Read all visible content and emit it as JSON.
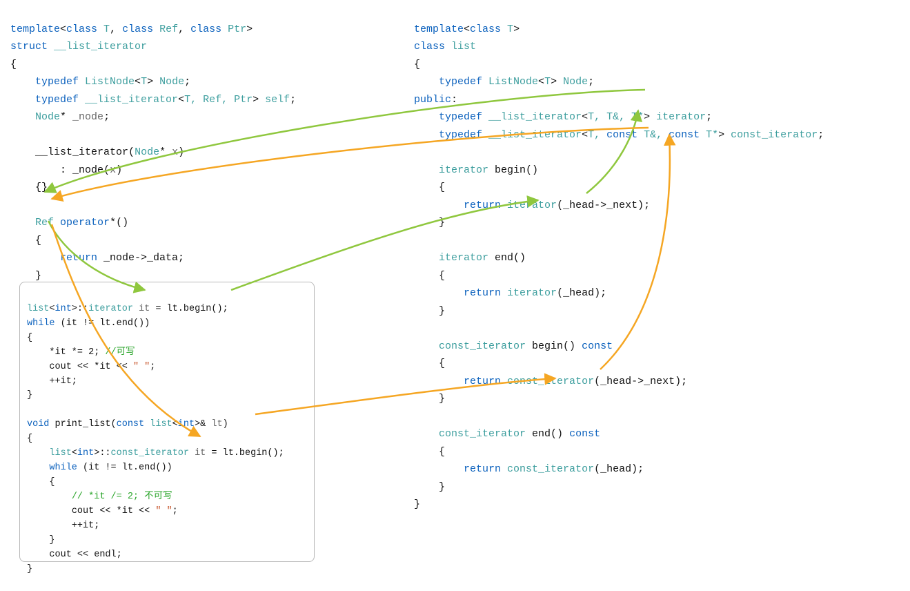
{
  "left_iterator": {
    "line1": {
      "kw1": "template",
      "p1": "<",
      "kw2": "class",
      "t1": " T",
      "c1": ", ",
      "kw3": "class",
      "t2": " Ref",
      "c2": ", ",
      "kw4": "class",
      "t3": " Ptr",
      "p2": ">"
    },
    "line2": {
      "kw": "struct",
      "name": " __list_iterator"
    },
    "line3": "{",
    "line4": {
      "indent": "    ",
      "kw": "typedef",
      "typ": " ListNode",
      "lt": "<",
      "tp": "T",
      "gt": "> ",
      "nm": "Node",
      "end": ";"
    },
    "line5": {
      "indent": "    ",
      "kw": "typedef",
      "typ": " __list_iterator",
      "lt": "<",
      "tp": "T, Ref, Ptr",
      "gt": "> ",
      "nm": "self",
      "end": ";"
    },
    "line6": {
      "indent": "    ",
      "typ": "Node",
      "star": "* ",
      "nm": "_node",
      "end": ";"
    },
    "line8": {
      "indent": "    ",
      "fn": "__list_iterator",
      "open": "(",
      "ptyp": "Node",
      "star": "* ",
      "px": "x",
      "close": ")"
    },
    "line9": {
      "indent": "        ",
      "colon": ": ",
      "fn": "_node",
      "open": "(",
      "arg": "x",
      "close": ")"
    },
    "line10": {
      "indent": "    ",
      "body": "{}"
    },
    "line12": {
      "indent": "    ",
      "typ": "Ref",
      "sp": " ",
      "kw": "operator",
      "op": "*()"
    },
    "line13": {
      "indent": "    ",
      "b": "{"
    },
    "line14": {
      "indent": "        ",
      "kw": "return",
      "expr": " _node->_data;"
    },
    "line15": {
      "indent": "    ",
      "b": "}"
    }
  },
  "snippet": {
    "s1": {
      "typ": "list",
      "lt": "<",
      "inn": "int",
      "gt": ">::",
      "it": "iterator",
      "sp": " ",
      "var": "it",
      "eq": " = ",
      "call": "lt.begin();"
    },
    "s2": {
      "kw": "while",
      "cond": " (it != lt.end())"
    },
    "s3": "{",
    "s4": {
      "indent": "    ",
      "expr": "*it *= 2; ",
      "cmt": "//可写"
    },
    "s5": {
      "indent": "    ",
      "cout": "cout << *it << ",
      "str": "\" \"",
      "end": ";"
    },
    "s6": {
      "indent": "    ",
      "expr": "++it;"
    },
    "s7": "}",
    "f1": {
      "kw": "void",
      "fn": " print_list(",
      "kw2": "const",
      "typ": " list",
      "lt": "<",
      "inn": "int",
      "gt": ">& ",
      "arg": "lt",
      "close": ")"
    },
    "f2": "{",
    "f3": {
      "indent": "    ",
      "typ": "list",
      "lt": "<",
      "inn": "int",
      "gt": ">::",
      "it": "const_iterator",
      "sp": " ",
      "var": "it",
      "eq": " = ",
      "call": "lt.begin();"
    },
    "f4": {
      "indent": "    ",
      "kw": "while",
      "cond": " (it != lt.end())"
    },
    "f5": {
      "indent": "    ",
      "b": "{"
    },
    "f6": {
      "indent": "        ",
      "cmt": "// *it /= 2; 不可写"
    },
    "f7": {
      "indent": "        ",
      "cout": "cout << *it << ",
      "str": "\" \"",
      "end": ";"
    },
    "f8": {
      "indent": "        ",
      "expr": "++it;"
    },
    "f9": {
      "indent": "    ",
      "b": "}"
    },
    "f10": {
      "indent": "    ",
      "cout": "cout << endl;"
    },
    "f11": "}"
  },
  "right_list": {
    "r1": {
      "kw1": "template",
      "p1": "<",
      "kw2": "class",
      "t1": " T",
      "p2": ">"
    },
    "r2": {
      "kw": "class",
      "name": " list"
    },
    "r3": "{",
    "r4": {
      "indent": "    ",
      "kw": "typedef",
      "typ": " ListNode",
      "lt": "<",
      "tp": "T",
      "gt": "> ",
      "nm": "Node",
      "end": ";"
    },
    "r5": {
      "kw": "public",
      "colon": ":"
    },
    "r6": {
      "indent": "    ",
      "kw": "typedef",
      "typ": " __list_iterator",
      "lt": "<",
      "args": "T, T&, T*",
      "gt": "> ",
      "nm": "iterator",
      "end": ";"
    },
    "r7": {
      "indent": "    ",
      "kw": "typedef",
      "typ": " __list_iterator",
      "lt": "<",
      "a1": "T, ",
      "kw2": "const",
      "a2": " T&, ",
      "kw3": "const",
      "a3": " T*",
      "gt": "> ",
      "nm": "const_iterator",
      "end": ";"
    },
    "r9": {
      "indent": "    ",
      "typ": "iterator",
      "fn": " begin()"
    },
    "r10": {
      "indent": "    ",
      "b": "{"
    },
    "r11": {
      "indent": "        ",
      "kw": "return",
      "sp": " ",
      "typ": "iterator",
      "args": "(_head->_next);"
    },
    "r12": {
      "indent": "    ",
      "b": "}"
    },
    "r14": {
      "indent": "    ",
      "typ": "iterator",
      "fn": " end()"
    },
    "r15": {
      "indent": "    ",
      "b": "{"
    },
    "r16": {
      "indent": "        ",
      "kw": "return",
      "sp": " ",
      "typ": "iterator",
      "args": "(_head);"
    },
    "r17": {
      "indent": "    ",
      "b": "}"
    },
    "r19": {
      "indent": "    ",
      "typ": "const_iterator",
      "fn": " begin() ",
      "kw": "const"
    },
    "r20": {
      "indent": "    ",
      "b": "{"
    },
    "r21": {
      "indent": "        ",
      "kw": "return",
      "sp": " ",
      "typ": "const_iterator",
      "args": "(_head->_next);"
    },
    "r22": {
      "indent": "    ",
      "b": "}"
    },
    "r24": {
      "indent": "    ",
      "typ": "const_iterator",
      "fn": " end() ",
      "kw": "const"
    },
    "r25": {
      "indent": "    ",
      "b": "{"
    },
    "r26": {
      "indent": "        ",
      "kw": "return",
      "sp": " ",
      "typ": "const_iterator",
      "args": "(_head);"
    },
    "r27": {
      "indent": "    ",
      "b": "}"
    },
    "r28": "}"
  },
  "colors": {
    "arrow_green": "#8fc73e",
    "arrow_yellow": "#f5a623"
  }
}
